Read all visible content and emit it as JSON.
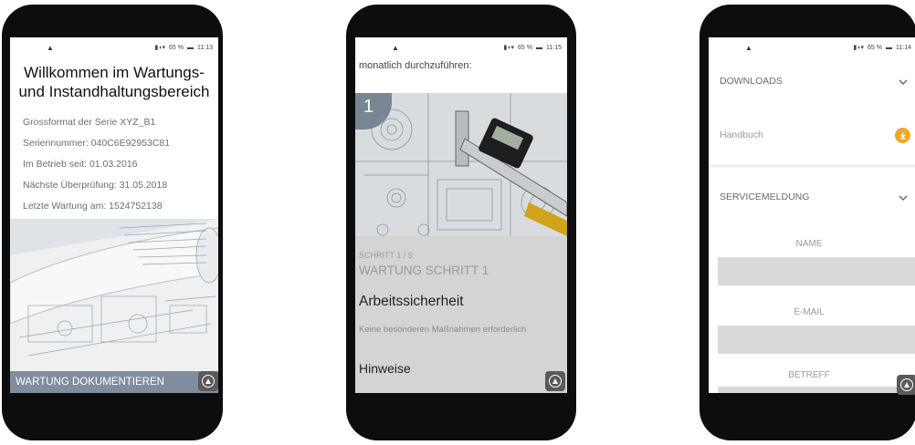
{
  "phone1": {
    "status_time": "11:13",
    "status_battery": "65 %",
    "title": "Willkommen im Wartungs- und Instandhaltungsbereich",
    "info": [
      "Grossformat der Serie XYZ_B1",
      "Seriennummer: 040C6E92953C81",
      "Im Betrieb seit: 01.03.2016",
      "Nächste Überprüfung: 31.05.2018",
      "Letzte Wartung am: 1524752138"
    ],
    "action_label": "WARTUNG DOKUMENTIEREN"
  },
  "phone2": {
    "status_time": "11:15",
    "status_battery": "65 %",
    "intro": "monatlich durchzuführen:",
    "step_number": "1",
    "step_counter": "SCHRITT 1 / 5:",
    "step_title": "WARTUNG SCHRITT 1",
    "section1_heading": "Arbeitssicherheit",
    "section1_text": "Keine besonderen Maßnahmen erforderlich",
    "section2_heading": "Hinweise"
  },
  "phone3": {
    "status_time": "11:14",
    "status_battery": "65 %",
    "downloads_label": "DOWNLOADS",
    "handbook_label": "Handbuch",
    "service_label": "SERVICEMELDUNG",
    "fields": [
      {
        "label": "NAME",
        "value": ""
      },
      {
        "label": "E-MAIL",
        "value": ""
      },
      {
        "label": "BETREFF",
        "value": ""
      }
    ]
  },
  "colors": {
    "accent_orange": "#f5a623",
    "action_bar": "#7f8d9f",
    "fab": "#5a5a5a"
  }
}
